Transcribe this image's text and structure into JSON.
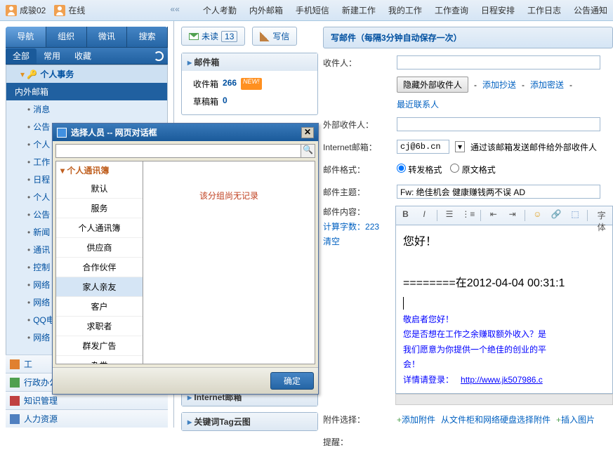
{
  "topbar": {
    "user1": "成骏02",
    "user2": "在线",
    "arrows": "««",
    "nav": [
      "个人考勤",
      "内外邮箱",
      "手机短信",
      "新建工作",
      "我的工作",
      "工作查询",
      "日程安排",
      "工作日志",
      "公告通知"
    ]
  },
  "leftnav": {
    "tabs": [
      "导航",
      "组织",
      "微讯",
      "搜索"
    ],
    "subtabs": [
      "全部",
      "常用",
      "收藏"
    ],
    "section_header": "个人事务",
    "selected_item": "内外邮箱",
    "items": [
      "消息",
      "公告",
      "个人",
      "工作",
      "日程",
      "个人",
      "公告",
      "新闻",
      "通讯",
      "控制",
      "网络",
      "网络",
      "QQ电",
      "网络"
    ],
    "bottom": [
      {
        "icon": "orange",
        "label": "工"
      },
      {
        "icon": "green",
        "label": "行政办公"
      },
      {
        "icon": "red",
        "label": "知识管理"
      },
      {
        "icon": "blue",
        "label": "人力资源"
      }
    ]
  },
  "midpanel": {
    "unread_label": "未读",
    "unread_count": "13",
    "write_label": "写信",
    "mailbox_header": "邮件箱",
    "inbox_label": "收件箱",
    "inbox_count": "266",
    "new_tag": "NEW!",
    "draft_label": "草稿箱",
    "draft_count": "0",
    "internet_header": "Internet邮箱",
    "tag_header": "关键词Tag云图"
  },
  "compose": {
    "title": "写邮件（每隔3分钟自动保存一次）",
    "to_label": "收件人：",
    "hide_ext": "隐藏外部收件人",
    "add_cc": "添加抄送",
    "add_bcc": "添加密送",
    "recent": "最近联系人",
    "ext_to_label": "外部收件人：",
    "internet_label": "Internet邮箱：",
    "internet_value": "cj@6b.cn",
    "internet_hint": "通过该邮箱发送邮件给外部收件人",
    "format_label": "邮件格式：",
    "format_forward": "转发格式",
    "format_original": "原文格式",
    "subject_label": "邮件主题：",
    "subject_value": "Fw: 绝佳机会 健康赚钱两不误 AD",
    "content_label": "邮件内容：",
    "count_label": "计算字数：",
    "count_value": "223",
    "clear": "清空",
    "toolbar_font": "字体",
    "body_greeting": "您好！",
    "body_divider": "========在2012-04-04 00:31:1",
    "body_l1": "敬启者您好！",
    "body_l2": "您是否想在工作之余赚取额外收入？是",
    "body_l3": "我们愿意为你提供一个绝佳的创业的平",
    "body_l4": "会！",
    "body_l5": "详情请登录：",
    "body_link": "http://www.jk507986.c",
    "attach_label": "附件选择：",
    "add_attach": "添加附件",
    "cabinet": "从文件柜和网络硬盘选择附件",
    "insert_img": "插入图片",
    "remind_label": "提醒："
  },
  "dialog": {
    "title": "选择人员 -- 网页对话框",
    "left_header": "个人通讯簿",
    "items": [
      "默认",
      "服务",
      "个人通讯簿",
      "供应商",
      "合作伙伴",
      "家人亲友",
      "客户",
      "求职者",
      "群发广告",
      "杂类"
    ],
    "selected_idx": 5,
    "empty_msg": "该分组尚无记录",
    "ok": "确定"
  }
}
